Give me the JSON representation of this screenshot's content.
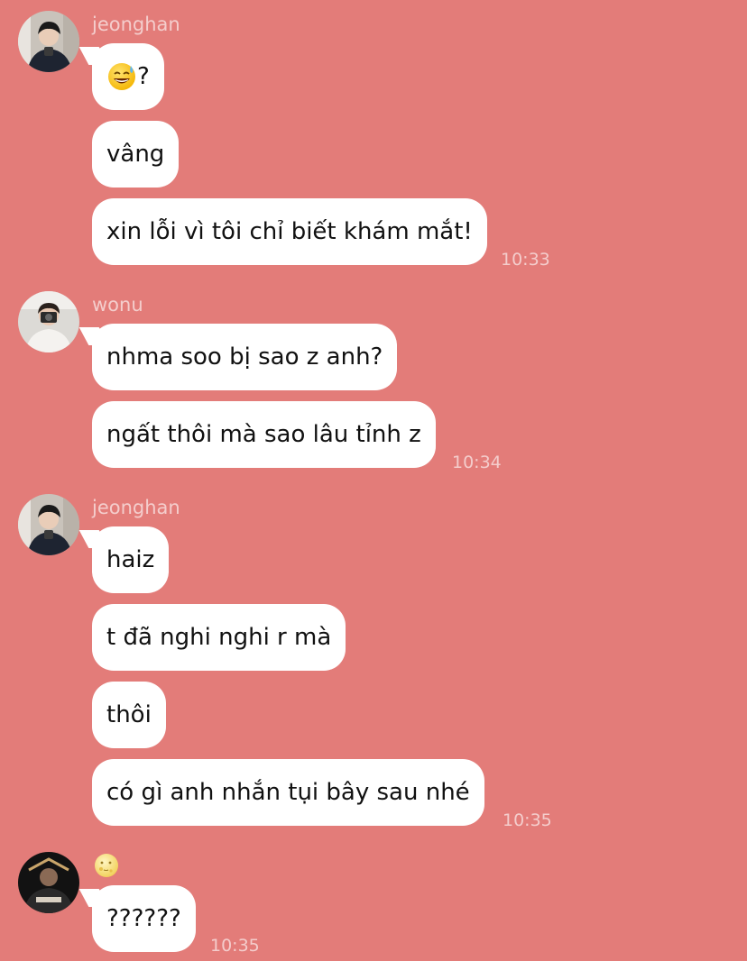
{
  "theme": {
    "background": "#e37c79",
    "bubble": "#ffffff",
    "meta_text": "rgba(255,255,255,0.62)"
  },
  "messages": [
    {
      "sender": "jeonghan",
      "avatar_icon": "avatar-photo-jeonghan",
      "bubbles": [
        {
          "emoji": "sweat-smile-emoji",
          "text": "?"
        },
        {
          "text": "vâng"
        },
        {
          "text": "xin lỗi vì tôi chỉ biết khám mắt!"
        }
      ],
      "time": "10:33"
    },
    {
      "sender": "wonu",
      "avatar_icon": "avatar-photo-wonu",
      "bubbles": [
        {
          "text": "nhma soo bị sao z anh?"
        },
        {
          "text": "ngất thôi mà sao lâu tỉnh z"
        }
      ],
      "time": "10:34"
    },
    {
      "sender": "jeonghan",
      "avatar_icon": "avatar-photo-jeonghan",
      "bubbles": [
        {
          "text": "haiz"
        },
        {
          "text": "t đã nghi nghi r mà"
        },
        {
          "text": "thôi"
        },
        {
          "text": "có gì anh nhắn tụi bây sau nhé"
        }
      ],
      "time": "10:35"
    },
    {
      "sender_icon": "moon-face-emoji",
      "avatar_icon": "avatar-photo-dark",
      "bubbles": [
        {
          "text": "??????"
        }
      ],
      "time": "10:35"
    }
  ]
}
